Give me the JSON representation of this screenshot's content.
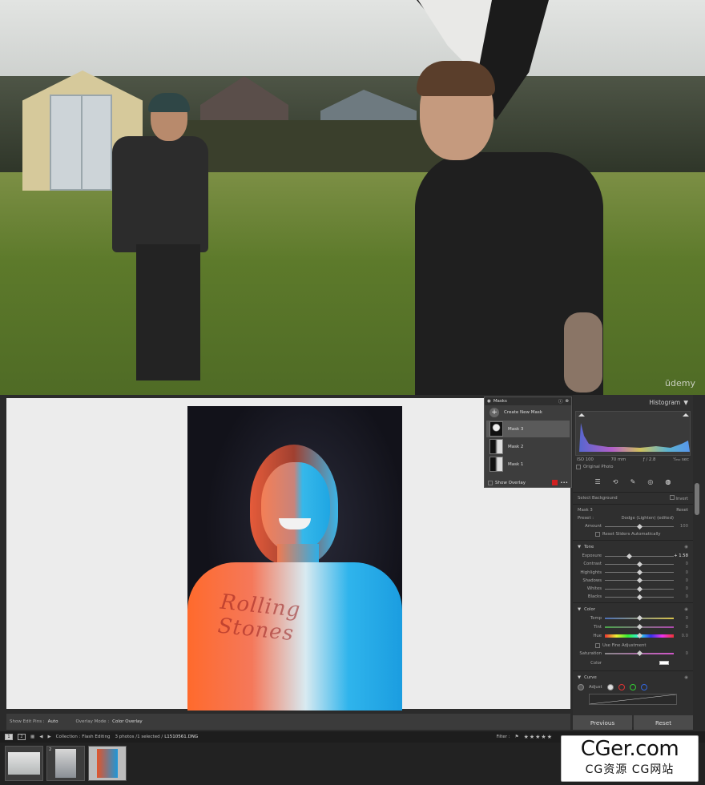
{
  "video": {
    "watermark": "ūdemy"
  },
  "masks_panel": {
    "title": "Masks",
    "create_label": "Create New Mask",
    "items": [
      {
        "label": "Mask 3",
        "selected": true
      },
      {
        "label": "Mask 2",
        "selected": false
      },
      {
        "label": "Mask 1",
        "selected": false
      }
    ],
    "show_overlay": "Show Overlay"
  },
  "photo": {
    "shirt_text": "Rolling Stones"
  },
  "toolbar": {
    "show_edit_pins_label": "Show Edit Pins :",
    "show_edit_pins_value": "Auto",
    "overlay_mode_label": "Overlay Mode :",
    "overlay_mode_value": "Color Overlay"
  },
  "histogram": {
    "title": "Histogram",
    "iso": "ISO 100",
    "focal": "70 mm",
    "aperture": "ƒ / 2.8",
    "shutter": "¹⁄₂₅₀ sec",
    "original_photo": "Original Photo"
  },
  "mask_edit": {
    "select_label": "Select Background",
    "invert_label": "Invert",
    "mask_name": "Mask 3",
    "reset_label": "Reset",
    "preset_label": "Preset :",
    "preset_value": "Dodge (Lighten) (edited)",
    "amount_label": "Amount",
    "amount_value": "100",
    "amount_fraction": 0.5,
    "reset_sliders_label": "Reset Sliders Automatically"
  },
  "light": {
    "title": "Tone",
    "sliders": [
      {
        "label": "Exposure",
        "value": "+ 1.58",
        "fraction": 0.35,
        "highlight": true
      },
      {
        "label": "Contrast",
        "value": "0",
        "fraction": 0.5,
        "highlight": false
      },
      {
        "label": "Highlights",
        "value": "0",
        "fraction": 0.5,
        "highlight": false
      },
      {
        "label": "Shadows",
        "value": "0",
        "fraction": 0.5,
        "highlight": false
      },
      {
        "label": "Whites",
        "value": "0",
        "fraction": 0.5,
        "highlight": false
      },
      {
        "label": "Blacks",
        "value": "0",
        "fraction": 0.5,
        "highlight": false
      }
    ]
  },
  "color": {
    "title": "Color",
    "temp_label": "Temp",
    "temp_value": "0",
    "tint_label": "Tint",
    "tint_value": "0",
    "hue_label": "Hue",
    "hue_value": "0.0",
    "fine_label": "Use Fine Adjustment",
    "saturation_label": "Saturation",
    "saturation_value": "0",
    "color_label": "Color"
  },
  "curve": {
    "title": "Curve",
    "adjust_label": "Adjust"
  },
  "nav": {
    "previous": "Previous",
    "reset": "Reset"
  },
  "filmstrip_bar": {
    "page1": "1",
    "page2": "2",
    "collection": "Collection : Flash Editing",
    "count": "3 photos /1 selected /",
    "filename": "L1510561.DNG",
    "filter_label": "Filter :",
    "stars": "★★★★★"
  },
  "filmstrip": {
    "thumbs": [
      {
        "num": "",
        "selected": false
      },
      {
        "num": "2",
        "selected": false
      },
      {
        "num": "",
        "selected": true
      }
    ]
  },
  "watermark": {
    "line1": "CGer.com",
    "line2": "CG资源 CG网站"
  },
  "lr_udemy": "ūdemy"
}
